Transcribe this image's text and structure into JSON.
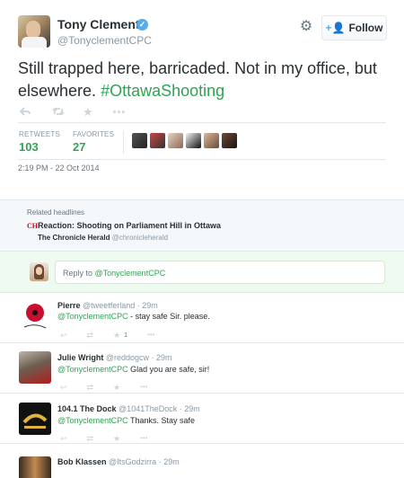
{
  "tweet": {
    "name": "Tony Clement",
    "handle": "@TonyclementCPC",
    "follow_label": "Follow",
    "text_plain": "Still trapped here, barricaded. Not in my office, but elsewhere. ",
    "hashtag": "#OttawaShooting",
    "actions": [
      "reply-icon",
      "retweet-icon",
      "favorite-icon",
      "more-icon"
    ],
    "retweets_label": "RETWEETS",
    "retweets": "103",
    "favorites_label": "FAVORITES",
    "favorites": "27",
    "timestamp": "2:19 PM - 22 Oct 2014"
  },
  "related": {
    "title": "Related headlines",
    "source_logo": "CH",
    "headline": "Reaction: Shooting on Parliament Hill in Ottawa",
    "source_name": "The Chronicle Herald",
    "source_handle": "@chronicleherald"
  },
  "reply_box": {
    "prefix": "Reply to ",
    "mention": "@TonyclementCPC"
  },
  "replies": [
    {
      "name": "Pierre",
      "handle": "@tweetferland",
      "time": "· 29m",
      "mention": "@TonyclementCPC",
      "text": " - stay safe Sir. please.",
      "favorites": "1"
    },
    {
      "name": "Julie Wright",
      "handle": "@reddogcw",
      "time": "· 29m",
      "mention": "@TonyclementCPC",
      "text": " Glad you are safe, sir!",
      "favorites": ""
    },
    {
      "name": "104.1 The Dock",
      "handle": "@1041TheDock",
      "time": "· 29m",
      "mention": "@TonyclementCPC",
      "text": " Thanks. Stay safe",
      "favorites": ""
    },
    {
      "name": "Bob Klassen",
      "handle": "@ItsGodzirra",
      "time": "· 29m"
    }
  ],
  "colors": {
    "link_green": "#30a355",
    "verified_blue": "#55acee",
    "muted": "#8899a6"
  }
}
